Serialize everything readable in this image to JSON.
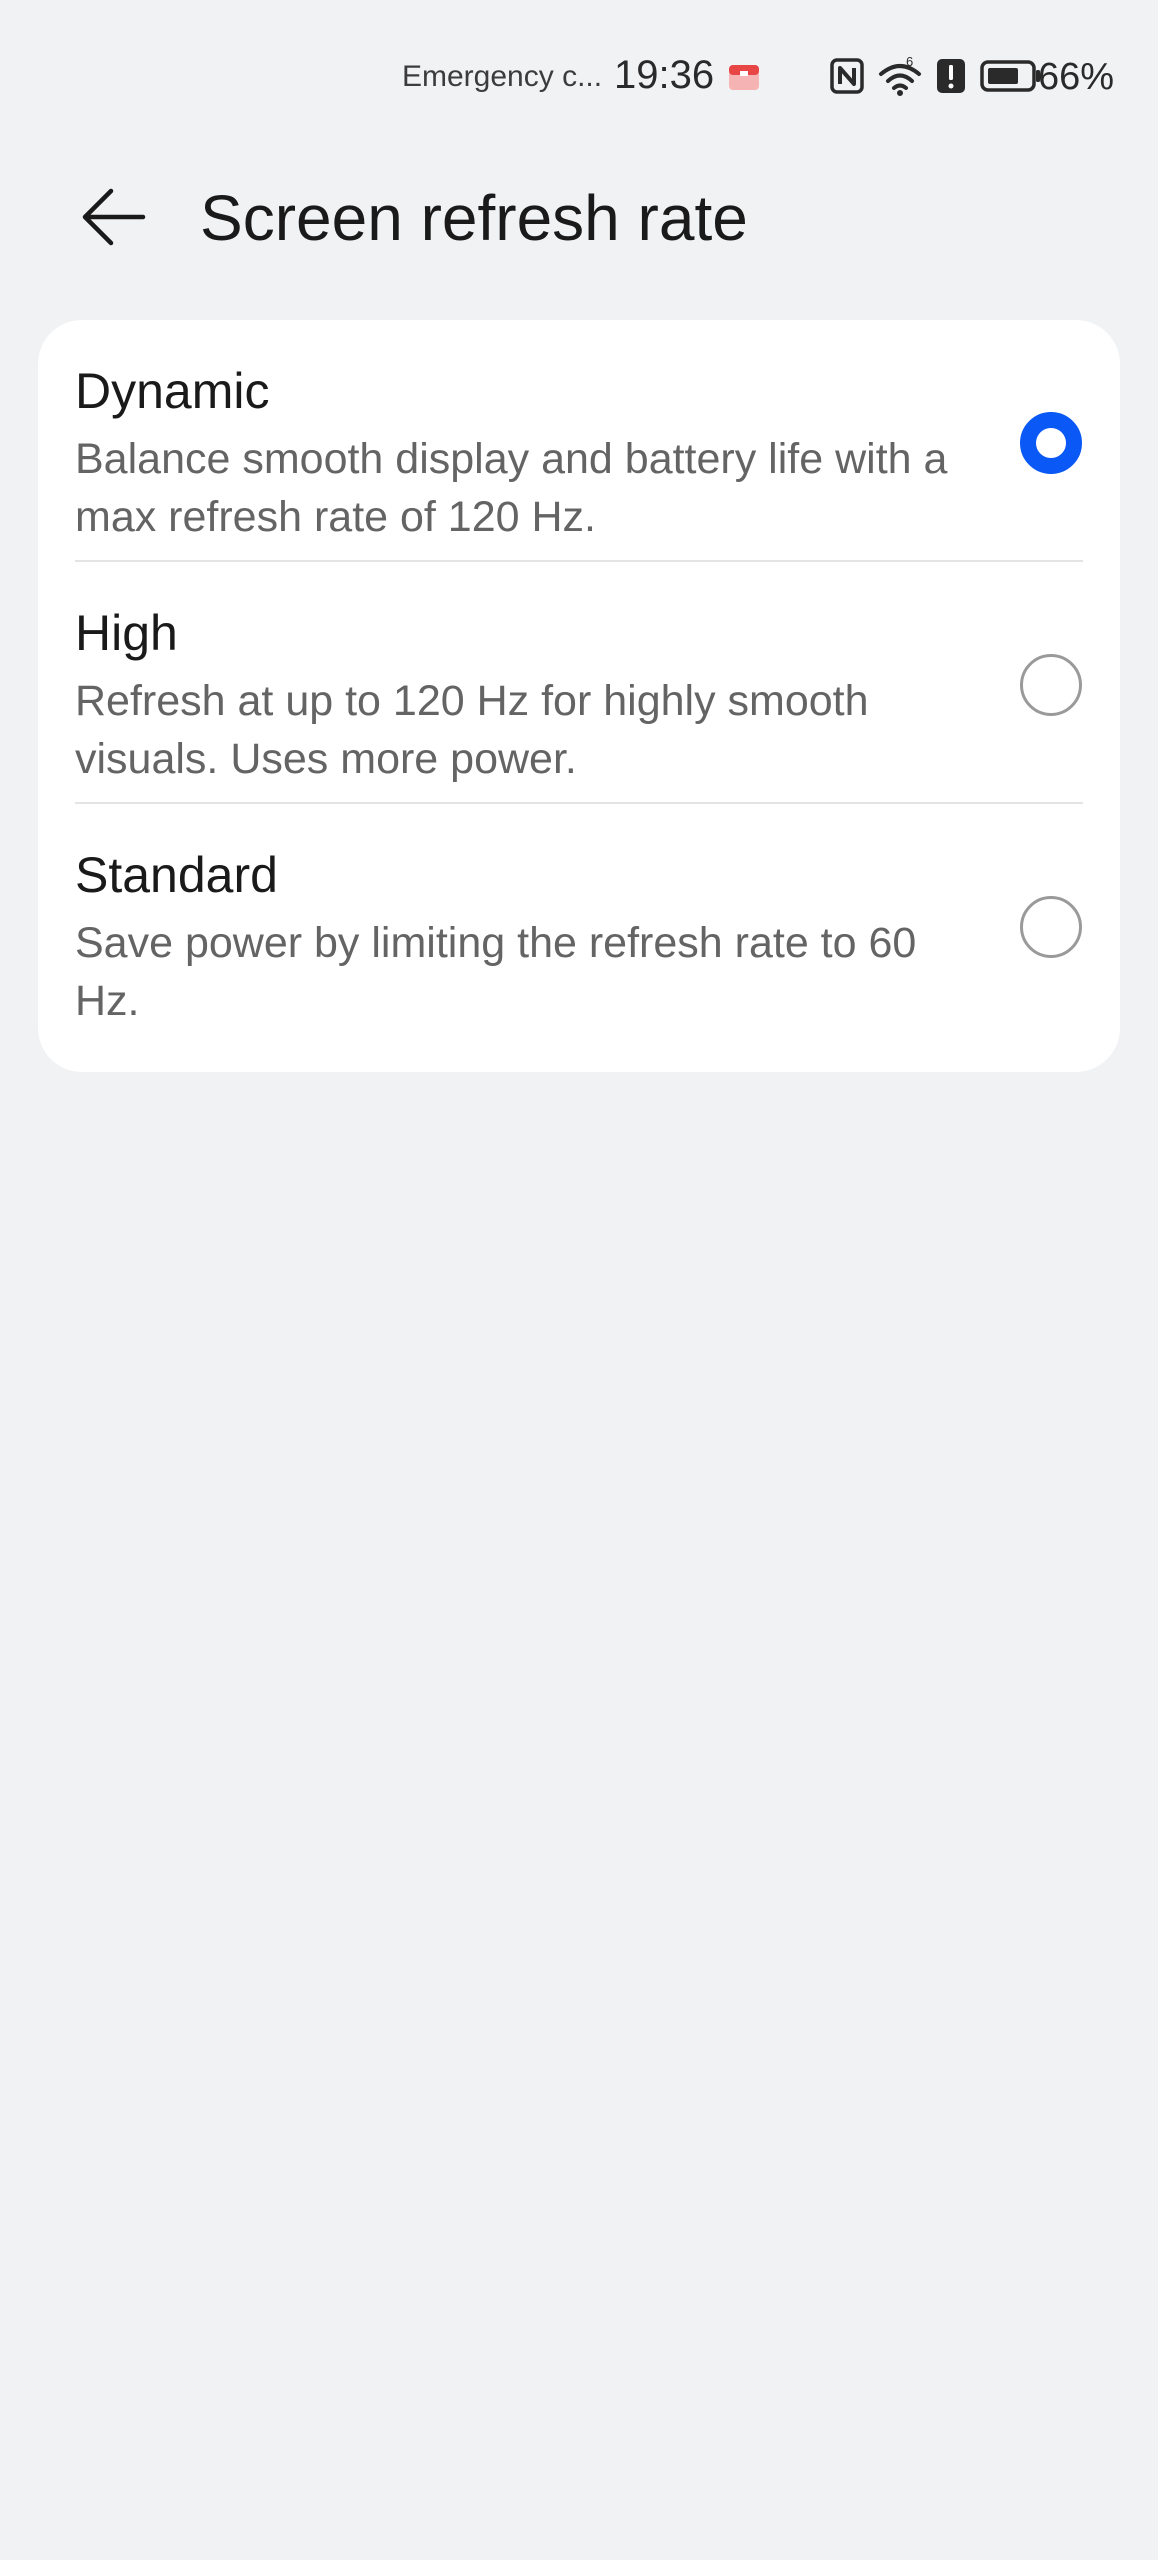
{
  "status_bar": {
    "carrier": "Emergency c...",
    "time": "19:36",
    "battery_percent": "66%",
    "signal_label": "6",
    "icons": [
      "notification-app-icon",
      "nfc-icon",
      "wifi-icon",
      "alert-icon",
      "battery-icon"
    ]
  },
  "header": {
    "title": "Screen refresh rate",
    "back_icon": "arrow-left-icon"
  },
  "options": [
    {
      "title": "Dynamic",
      "description": "Balance smooth display and battery life with a max refresh rate of 120 Hz.",
      "selected": true
    },
    {
      "title": "High",
      "description": "Refresh at up to 120 Hz for highly smooth visuals. Uses more power.",
      "selected": false
    },
    {
      "title": "Standard",
      "description": "Save power by limiting the refresh rate to 60 Hz.",
      "selected": false
    }
  ],
  "colors": {
    "accent": "#0a59f7",
    "background": "#f1f2f4",
    "card": "#ffffff"
  }
}
